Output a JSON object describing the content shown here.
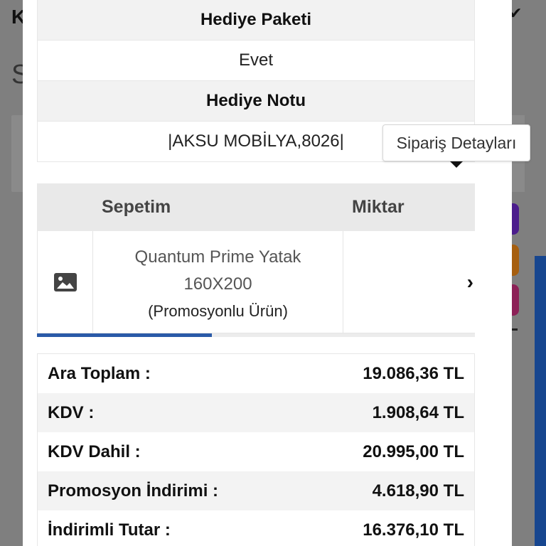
{
  "background": {
    "letter_k": "K",
    "letter_s": "S"
  },
  "gift": {
    "package_header": "Hediye Paketi",
    "package_value": "Evet",
    "note_header": "Hediye Notu",
    "note_value": "|AKSU MOBİLYA,8026|"
  },
  "tooltip": {
    "text": "Sipariş Detayları"
  },
  "cart": {
    "columns": [
      "Sepetim",
      "Miktar"
    ],
    "items": [
      {
        "icon": "image-icon",
        "name": "Quantum Prime Yatak 160X200",
        "promo": "(Promosyonlu Ürün)"
      }
    ],
    "scroll_fraction": 0.4
  },
  "totals": [
    {
      "label": "Ara Toplam :",
      "value": "19.086,36 TL"
    },
    {
      "label": "KDV :",
      "value": "1.908,64 TL"
    },
    {
      "label": "KDV Dahil :",
      "value": "20.995,00 TL"
    },
    {
      "label": "Promosyon İndirimi :",
      "value": "4.618,90 TL"
    },
    {
      "label": "İndirimli Tutar :",
      "value": "16.376,10 TL"
    }
  ],
  "colors": {
    "accent_blue": "#2a5aa8",
    "button_purple": "#4b1d8c",
    "button_orange": "#a65f10",
    "button_magenta": "#8c2157"
  }
}
